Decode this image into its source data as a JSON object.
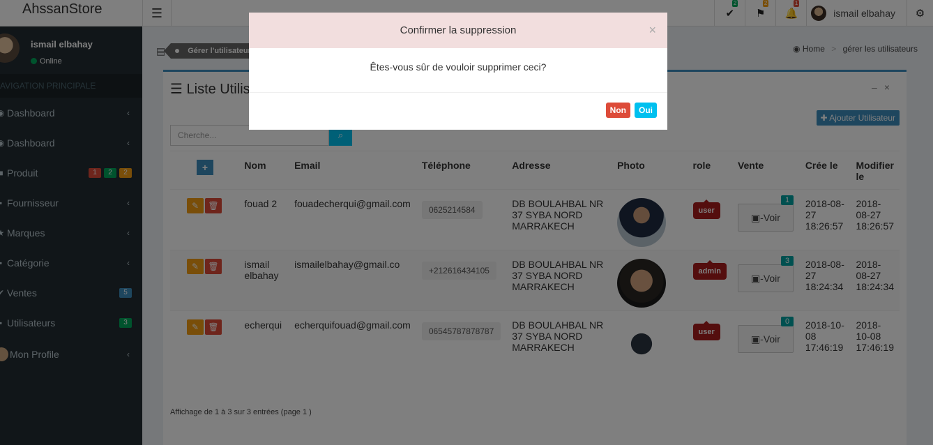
{
  "app": {
    "logo": "AhssanStore"
  },
  "header": {
    "toggle_icon": "hamburger-icon",
    "badges": [
      {
        "icon": "check-icon",
        "count": "2",
        "color": "#00a65a"
      },
      {
        "icon": "flag-icon",
        "count": "2",
        "color": "#f39c12"
      },
      {
        "icon": "bell-icon",
        "count": "1",
        "color": "#dd4b39"
      }
    ],
    "user_name": "ismail elbahay",
    "settings_icon": "cogs-icon"
  },
  "sidebar": {
    "user_name": "ismail elbahay",
    "status": "Online",
    "nav_header": "AVIGATION PRINCIPALE",
    "items": [
      {
        "label": "Dashboard",
        "icon": "dashboard-icon"
      },
      {
        "label": "Dashboard",
        "icon": "dashboard-icon"
      },
      {
        "label": "Produit",
        "icon": "box-icon",
        "badges": [
          "1",
          "2",
          "2"
        ]
      },
      {
        "label": "Fournisseur",
        "icon": "truck-icon"
      },
      {
        "label": "Marques",
        "icon": "star-icon"
      },
      {
        "label": "Catégorie",
        "icon": "tags-icon"
      },
      {
        "label": "Ventes",
        "icon": "check-icon",
        "badge": "5"
      },
      {
        "label": "Utilisateurs",
        "icon": "users-icon",
        "badge": "3"
      },
      {
        "label": "Mon Profile",
        "icon": "avatar-icon"
      }
    ],
    "badge_colors": {
      "red": "#dd4b39",
      "green": "#00a65a",
      "orange": "#f39c12",
      "blue": "#3c8dbc"
    }
  },
  "breadcrumb": {
    "current_tag": "Gérer l'utilisateur",
    "home": "Home",
    "page": "gérer les utilisateurs"
  },
  "box": {
    "title": "Liste Utilisa",
    "add_button": "Ajouter Utilisateur",
    "search_placeholder": "Cherche...",
    "footer": "Affichage de 1 à 3 sur 3 entrées (page 1 )"
  },
  "table": {
    "headers": [
      "Nom",
      "Email",
      "Téléphone",
      "Adresse",
      "Photo",
      "role",
      "Vente",
      "Crée le",
      "Modifier le"
    ],
    "rows": [
      {
        "nom": "fouad 2",
        "email": "fouadecherqui@gmail.com",
        "phone": "0625214584",
        "adresse": "DB BOULAHBAL NR 37 SYBA NORD MARRAKECH",
        "role": "user",
        "vente_label": "-Voir",
        "vente_count": "1",
        "cree": "2018-08-27 18:26:57",
        "modifie": "2018-08-27 18:26:57"
      },
      {
        "nom": "ismail elbahay",
        "email": "ismailelbahay@gmail.co",
        "phone": "+212616434105",
        "adresse": "DB BOULAHBAL NR 37 SYBA NORD MARRAKECH",
        "role": "admin",
        "vente_label": "-Voir",
        "vente_count": "3",
        "cree": "2018-08-27 18:24:34",
        "modifie": "2018-08-27 18:24:34"
      },
      {
        "nom": "echerqui",
        "email": "echerquifouad@gmail.com",
        "phone": "06545787878787",
        "adresse": "DB BOULAHBAL NR 37 SYBA NORD MARRAKECH",
        "role": "user",
        "vente_label": "-Voir",
        "vente_count": "0",
        "cree": "2018-10-08 17:46:19",
        "modifie": "2018-10-08 17:46:19"
      }
    ]
  },
  "modal": {
    "title": "Confirmer la suppression",
    "close": "×",
    "message": "Êtes-vous sûr de vouloir supprimer ceci?",
    "no": "Non",
    "yes": "Oui"
  }
}
